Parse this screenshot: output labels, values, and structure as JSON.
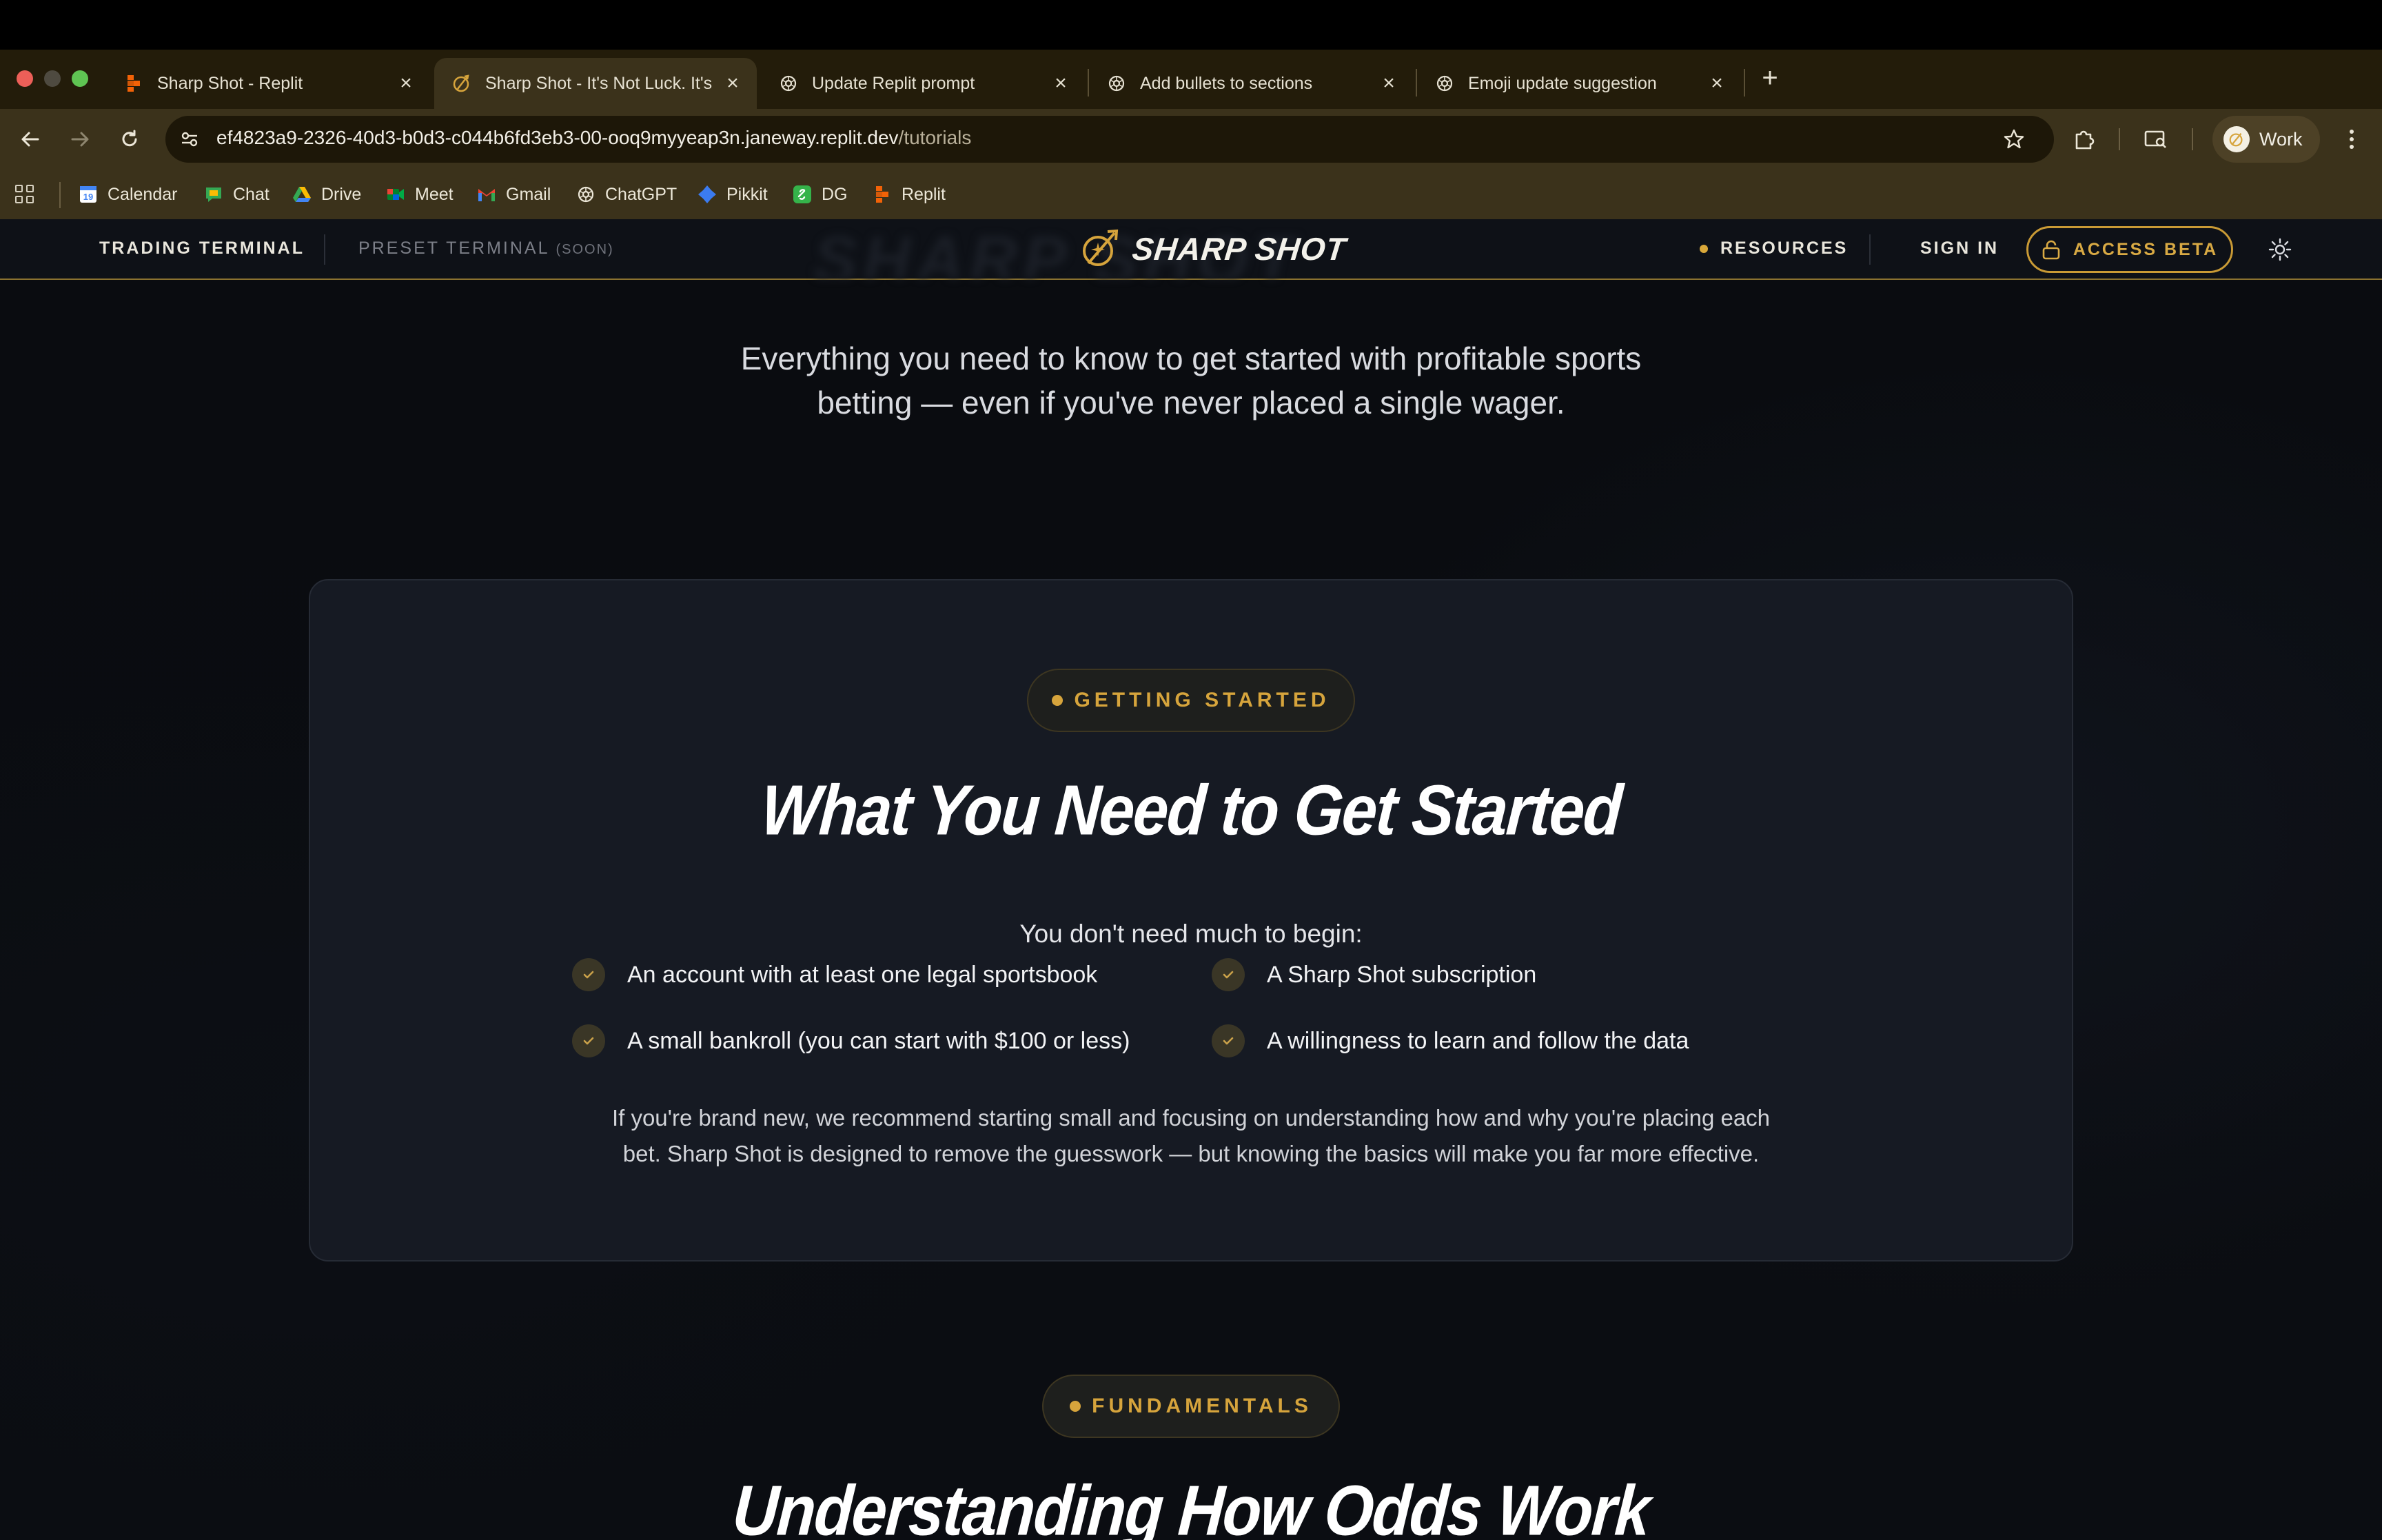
{
  "browser": {
    "tabs": [
      {
        "label": "Sharp Shot - Replit",
        "icon": "replit-icon",
        "active": false
      },
      {
        "label": "Sharp Shot - It's Not Luck. It's",
        "icon": "sharpshot-icon",
        "active": true
      },
      {
        "label": "Update Replit prompt",
        "icon": "chatgpt-icon",
        "active": false
      },
      {
        "label": "Add bullets to sections",
        "icon": "chatgpt-icon",
        "active": false
      },
      {
        "label": "Emoji update suggestion",
        "icon": "chatgpt-icon",
        "active": false
      }
    ],
    "close_glyph": "×",
    "new_tab_glyph": "+",
    "url_host": "ef4823a9-2326-40d3-b0d3-c044b6fd3eb3-00-ooq9myyeap3n.janeway.replit.dev",
    "url_path": "/tutorials",
    "profile_label": "Work",
    "bookmarks": [
      "Calendar",
      "Chat",
      "Drive",
      "Meet",
      "Gmail",
      "ChatGPT",
      "Pikkit",
      "DG",
      "Replit"
    ],
    "calendar_day": "19"
  },
  "site": {
    "nav": {
      "trading_terminal": "TRADING TERMINAL",
      "preset_terminal": "PRESET TERMINAL",
      "preset_soon": "(SOON)",
      "brand": "SHARP SHOT",
      "resources": "RESOURCES",
      "sign_in": "SIGN IN",
      "access_beta": "ACCESS BETA"
    },
    "intro_line1": "Everything you need to know to get started with profitable sports",
    "intro_line2": "betting — even if you've never placed a single wager.",
    "getting_started": {
      "pill": "GETTING STARTED",
      "title": "What You Need to Get Started",
      "subtitle": "You don't need much to begin:",
      "checklist": [
        "An account with at least one legal sportsbook",
        "A Sharp Shot subscription",
        "A small bankroll (you can start with $100 or less)",
        "A willingness to learn and follow the data"
      ],
      "paragraph_line1": "If you're brand new, we recommend starting small and focusing on understanding how and why you're placing each",
      "paragraph_line2": "bet. Sharp Shot is designed to remove the guesswork — but knowing the basics will make you far more effective."
    },
    "fundamentals": {
      "pill": "FUNDAMENTALS",
      "title": "Understanding How Odds Work"
    }
  },
  "colors": {
    "accent": "#d6a43c",
    "chrome": "#3b321b",
    "card": "#161a23"
  }
}
